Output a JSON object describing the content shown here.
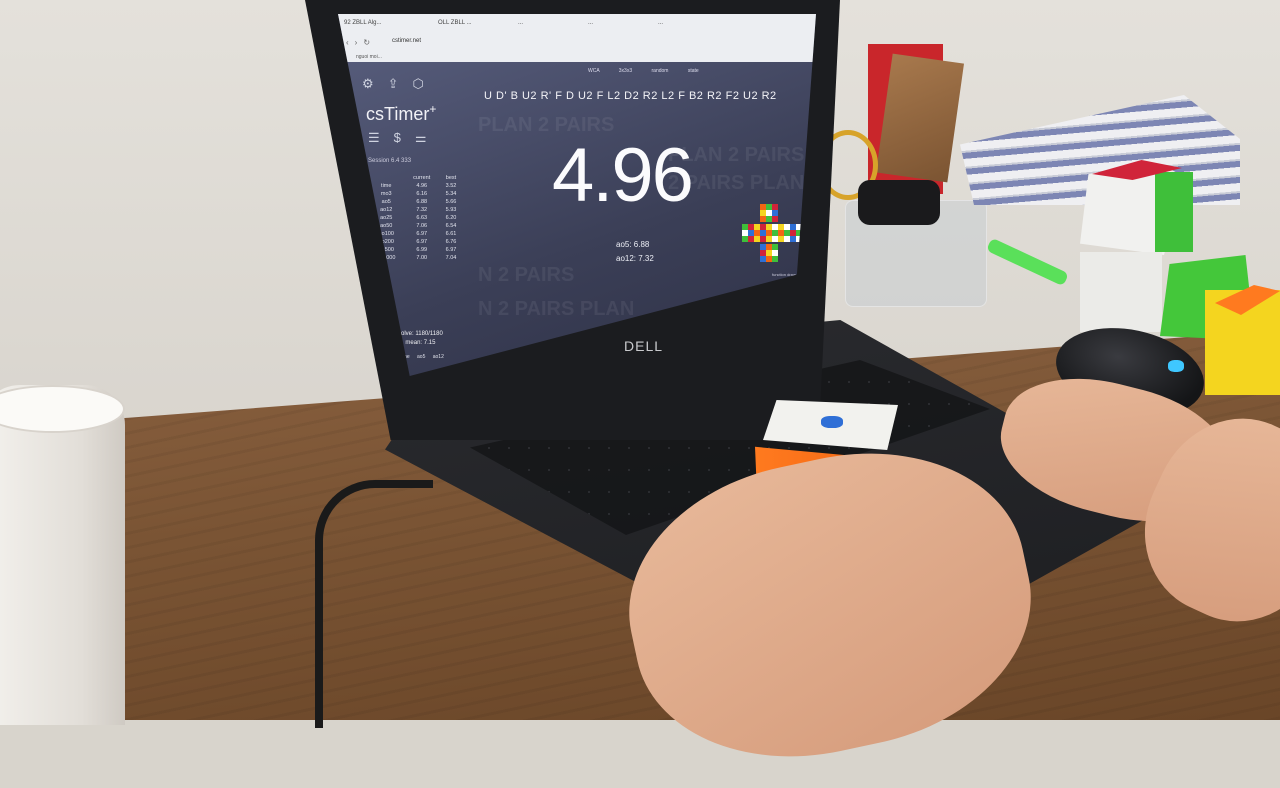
{
  "browser": {
    "tabs": [
      "92 ZBLL Alg...",
      "OLL ZBLL ...",
      "...",
      "...",
      "..."
    ],
    "url": "cstimer.net",
    "bookmark": "nguoi moi..."
  },
  "app": {
    "logo": "csTimer",
    "logo_sup": "+",
    "session_label": "Session",
    "session_value": "6.4 333",
    "header_tools": [
      "WCA",
      "3x3x3",
      "random state"
    ],
    "scramble": "U D' B U2 R' F D U2 F L2 D2 R2 L2 F B2 R2 F2 U2 R2",
    "time": "4.96",
    "ao5": "ao5: 6.88",
    "ao12": "ao12: 7.32",
    "background_text": [
      "PLAN 2 PAIRS",
      "PLAN 2 PAIRS",
      "2 PAIRS PLAN",
      "N 2 PAIRS",
      "N 2 PAIRS  PLAN"
    ],
    "stats_headers": [
      "",
      "current",
      "best"
    ],
    "stats_rows": [
      [
        "time",
        "4.96",
        "3.52"
      ],
      [
        "mo3",
        "6.16",
        "5.34"
      ],
      [
        "ao5",
        "6.88",
        "5.66"
      ],
      [
        "ao12",
        "7.32",
        "5.93"
      ],
      [
        "ao25",
        "6.63",
        "6.20"
      ],
      [
        "ao50",
        "7.06",
        "6.54"
      ],
      [
        "ao100",
        "6.97",
        "6.61"
      ],
      [
        "ao200",
        "6.97",
        "6.76"
      ],
      [
        "ao500",
        "6.99",
        "6.97"
      ],
      [
        "ao1000",
        "7.00",
        "7.04"
      ]
    ],
    "solve_count": "solve: 1180/1180",
    "mean": "mean: 7.15",
    "footer_cols": "# time ao5 ao12",
    "net_label": "function  draw scramble"
  },
  "laptop": {
    "brand": "DELL"
  },
  "colors": {
    "screen_bg": "#3b3f57",
    "cube_orange": "#f26612",
    "cube_green": "#3fbf3a",
    "cube_red": "#d0243a",
    "cube_yellow": "#f4d51f"
  }
}
